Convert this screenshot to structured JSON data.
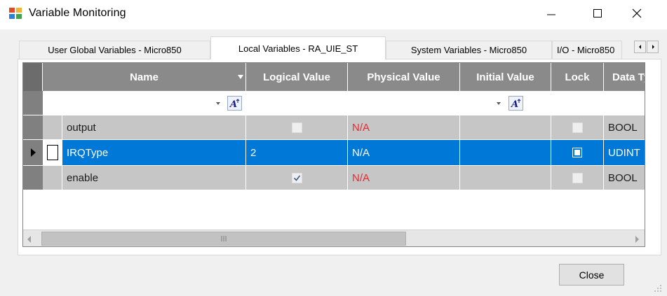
{
  "window": {
    "title": "Variable Monitoring",
    "icon": "app-window-icon",
    "controls": [
      "minimize-icon",
      "maximize-icon",
      "close-icon"
    ]
  },
  "tabs": [
    {
      "label": "User Global Variables - Micro850",
      "active": false
    },
    {
      "label": "Local Variables - RA_UIE_ST",
      "active": true
    },
    {
      "label": "System Variables - Micro850",
      "active": false
    },
    {
      "label": "I/O - Micro850",
      "active": false
    }
  ],
  "grid": {
    "columns": [
      "Name",
      "Logical Value",
      "Physical Value",
      "Initial Value",
      "Lock",
      "Data Type"
    ],
    "rows": [
      {
        "name": "output",
        "logical": "",
        "logical_checkbox": "unchecked",
        "physical": "N/A",
        "physical_color": "#e8292f",
        "initial": "",
        "lock": "unchecked",
        "data_type": "BOOL",
        "selected": false
      },
      {
        "name": "IRQType",
        "logical": "2",
        "logical_checkbox": "none",
        "physical": "N/A",
        "physical_color": "#ffffff",
        "initial": "",
        "lock": "unchecked",
        "data_type": "UDINT",
        "selected": true
      },
      {
        "name": "enable",
        "logical": "",
        "logical_checkbox": "checked",
        "physical": "N/A",
        "physical_color": "#e8292f",
        "initial": "",
        "lock": "unchecked",
        "data_type": "BOOL",
        "selected": false
      }
    ]
  },
  "buttons": {
    "close_label": "Close"
  },
  "colors": {
    "header_bg": "#8a8a8a",
    "row_gray": "#c6c6c6",
    "selection": "#0078d7",
    "na_red": "#e8292f"
  }
}
